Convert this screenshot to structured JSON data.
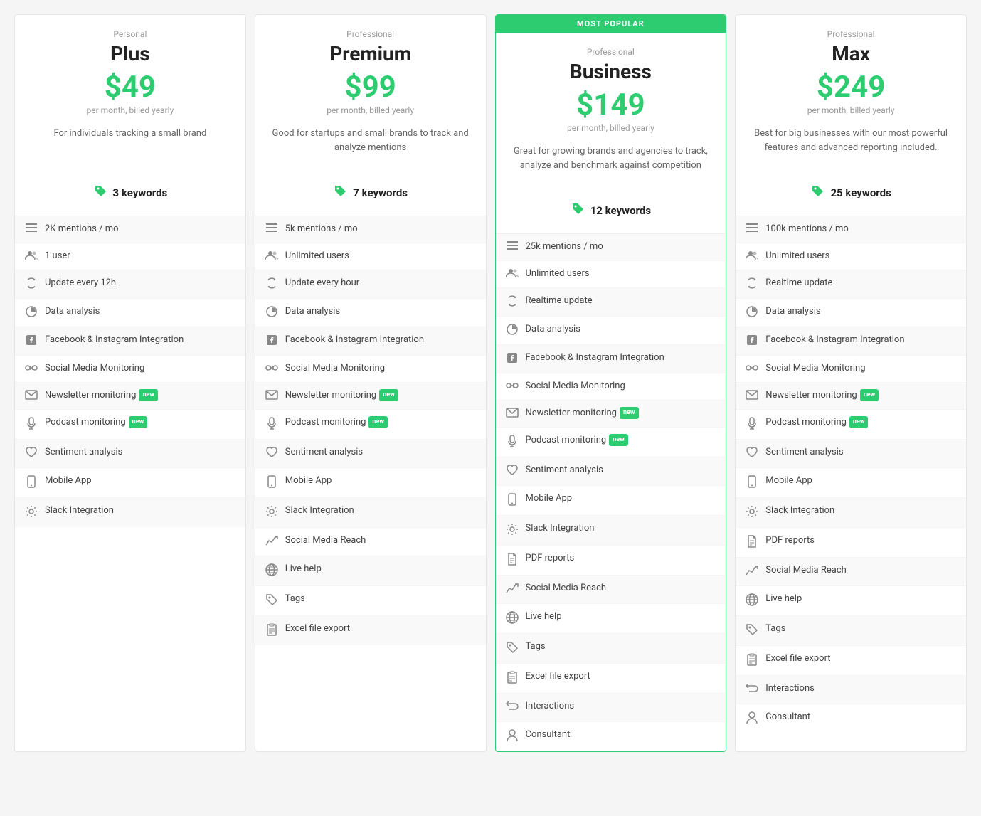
{
  "plans": [
    {
      "id": "plus",
      "tier": "Personal",
      "name": "Plus",
      "price": "$49",
      "billing": "per month, billed yearly",
      "description": "For individuals tracking a small brand",
      "keywords": "3 keywords",
      "popular": false,
      "features": [
        {
          "icon": "≡",
          "text": "2K mentions / mo",
          "new": false
        },
        {
          "icon": "👥",
          "text": "1 user",
          "new": false
        },
        {
          "icon": "🔄",
          "text": "Update every 12h",
          "new": false
        },
        {
          "icon": "📊",
          "text": "Data analysis",
          "new": false
        },
        {
          "icon": "f",
          "text": "Facebook & Instagram Integration",
          "new": false
        },
        {
          "icon": "⟨⟩",
          "text": "Social Media Monitoring",
          "new": false
        },
        {
          "icon": "✉",
          "text": "Newsletter monitoring",
          "new": true
        },
        {
          "icon": "🎙",
          "text": "Podcast monitoring",
          "new": true
        },
        {
          "icon": "♥",
          "text": "Sentiment analysis",
          "new": false
        },
        {
          "icon": "📱",
          "text": "Mobile App",
          "new": false
        },
        {
          "icon": "⚙",
          "text": "Slack Integration",
          "new": false
        }
      ]
    },
    {
      "id": "premium",
      "tier": "Professional",
      "name": "Premium",
      "price": "$99",
      "billing": "per month, billed yearly",
      "description": "Good for startups and small brands to track and analyze mentions",
      "keywords": "7 keywords",
      "popular": false,
      "features": [
        {
          "icon": "≡",
          "text": "5k mentions / mo",
          "new": false
        },
        {
          "icon": "👥",
          "text": "Unlimited users",
          "new": false
        },
        {
          "icon": "🔄",
          "text": "Update every hour",
          "new": false
        },
        {
          "icon": "📊",
          "text": "Data analysis",
          "new": false
        },
        {
          "icon": "f",
          "text": "Facebook & Instagram Integration",
          "new": false
        },
        {
          "icon": "⟨⟩",
          "text": "Social Media Monitoring",
          "new": false
        },
        {
          "icon": "✉",
          "text": "Newsletter monitoring",
          "new": true
        },
        {
          "icon": "🎙",
          "text": "Podcast monitoring",
          "new": true
        },
        {
          "icon": "♥",
          "text": "Sentiment analysis",
          "new": false
        },
        {
          "icon": "📱",
          "text": "Mobile App",
          "new": false
        },
        {
          "icon": "⚙",
          "text": "Slack Integration",
          "new": false
        },
        {
          "icon": "📈",
          "text": "Social Media Reach",
          "new": false
        },
        {
          "icon": "🌐",
          "text": "Live help",
          "new": false
        },
        {
          "icon": "🏷",
          "text": "Tags",
          "new": false
        },
        {
          "icon": "📋",
          "text": "Excel file export",
          "new": false
        }
      ]
    },
    {
      "id": "business",
      "tier": "Professional",
      "name": "Business",
      "price": "$149",
      "billing": "per month, billed yearly",
      "description": "Great for growing brands and agencies to track, analyze and benchmark against competition",
      "keywords": "12 keywords",
      "popular": true,
      "most_popular_label": "MOST POPULAR",
      "features": [
        {
          "icon": "≡",
          "text": "25k mentions / mo",
          "new": false
        },
        {
          "icon": "👥",
          "text": "Unlimited users",
          "new": false
        },
        {
          "icon": "🔄",
          "text": "Realtime update",
          "new": false
        },
        {
          "icon": "📊",
          "text": "Data analysis",
          "new": false
        },
        {
          "icon": "f",
          "text": "Facebook & Instagram Integration",
          "new": false
        },
        {
          "icon": "⟨⟩",
          "text": "Social Media Monitoring",
          "new": false
        },
        {
          "icon": "✉",
          "text": "Newsletter monitoring",
          "new": true
        },
        {
          "icon": "🎙",
          "text": "Podcast monitoring",
          "new": true
        },
        {
          "icon": "♥",
          "text": "Sentiment analysis",
          "new": false
        },
        {
          "icon": "📱",
          "text": "Mobile App",
          "new": false
        },
        {
          "icon": "⚙",
          "text": "Slack Integration",
          "new": false
        },
        {
          "icon": "📄",
          "text": "PDF reports",
          "new": false
        },
        {
          "icon": "📈",
          "text": "Social Media Reach",
          "new": false
        },
        {
          "icon": "🌐",
          "text": "Live help",
          "new": false
        },
        {
          "icon": "🏷",
          "text": "Tags",
          "new": false
        },
        {
          "icon": "📋",
          "text": "Excel file export",
          "new": false
        },
        {
          "icon": "🔁",
          "text": "Interactions",
          "new": false
        },
        {
          "icon": "👤",
          "text": "Consultant",
          "new": false
        }
      ]
    },
    {
      "id": "max",
      "tier": "Professional",
      "name": "Max",
      "price": "$249",
      "billing": "per month, billed yearly",
      "description": "Best for big businesses with our most powerful features and advanced reporting included.",
      "keywords": "25 keywords",
      "popular": false,
      "features": [
        {
          "icon": "≡",
          "text": "100k mentions / mo",
          "new": false
        },
        {
          "icon": "👥",
          "text": "Unlimited users",
          "new": false
        },
        {
          "icon": "🔄",
          "text": "Realtime update",
          "new": false
        },
        {
          "icon": "📊",
          "text": "Data analysis",
          "new": false
        },
        {
          "icon": "f",
          "text": "Facebook & Instagram Integration",
          "new": false
        },
        {
          "icon": "⟨⟩",
          "text": "Social Media Monitoring",
          "new": false
        },
        {
          "icon": "✉",
          "text": "Newsletter monitoring",
          "new": true
        },
        {
          "icon": "🎙",
          "text": "Podcast monitoring",
          "new": true
        },
        {
          "icon": "♥",
          "text": "Sentiment analysis",
          "new": false
        },
        {
          "icon": "📱",
          "text": "Mobile App",
          "new": false
        },
        {
          "icon": "⚙",
          "text": "Slack Integration",
          "new": false
        },
        {
          "icon": "📄",
          "text": "PDF reports",
          "new": false
        },
        {
          "icon": "📈",
          "text": "Social Media Reach",
          "new": false
        },
        {
          "icon": "🌐",
          "text": "Live help",
          "new": false
        },
        {
          "icon": "🏷",
          "text": "Tags",
          "new": false
        },
        {
          "icon": "📋",
          "text": "Excel file export",
          "new": false
        },
        {
          "icon": "🔁",
          "text": "Interactions",
          "new": false
        },
        {
          "icon": "👤",
          "text": "Consultant",
          "new": false
        }
      ]
    }
  ]
}
